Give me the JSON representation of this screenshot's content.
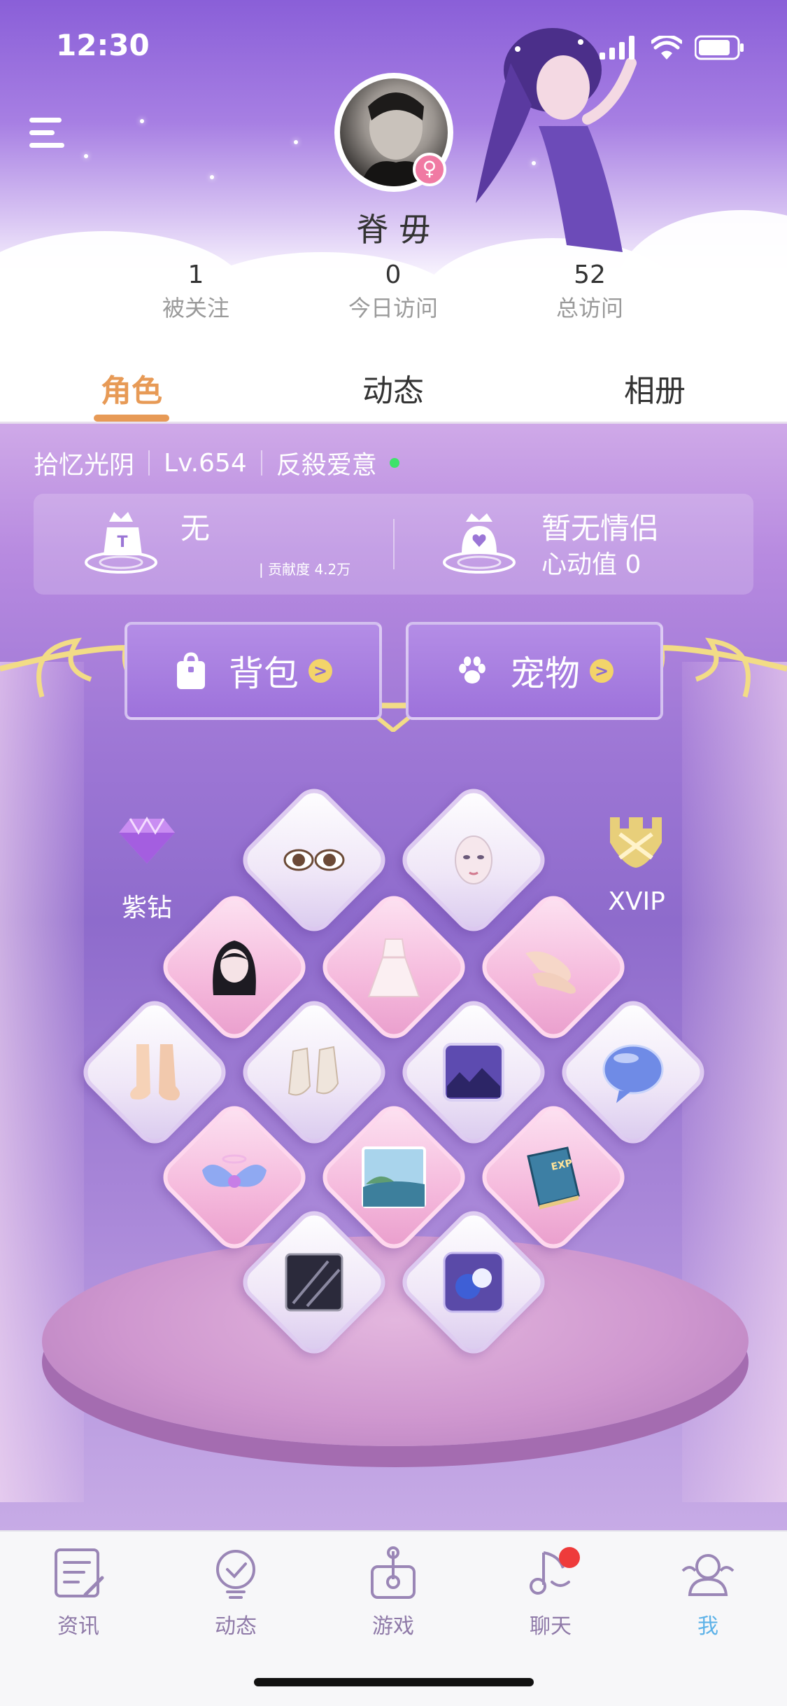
{
  "status_bar": {
    "time": "12:30"
  },
  "profile": {
    "username": "脊 毋",
    "gender_symbol": "♀",
    "stats": [
      {
        "value": "1",
        "label": "被关注"
      },
      {
        "value": "0",
        "label": "今日访问"
      },
      {
        "value": "52",
        "label": "总访问"
      }
    ]
  },
  "tabs": [
    {
      "label": "角色",
      "active": true
    },
    {
      "label": "动态",
      "active": false
    },
    {
      "label": "相册",
      "active": false
    }
  ],
  "role": {
    "name": "拾忆光阴",
    "level": "Lv.654",
    "guild": "反殺爱意",
    "online": true
  },
  "panel": {
    "rank_title": "无",
    "contribution": "| 贡献度 4.2万",
    "couple_title": "暂无情侣",
    "heart_value": "心动值 0"
  },
  "buttons": {
    "backpack": "背包",
    "pet": "宠物",
    "chevron": ">"
  },
  "side": {
    "diamond_label": "紫钻",
    "vip_label": "XVIP"
  },
  "bottom_nav": [
    {
      "label": "资讯",
      "icon": "news-icon",
      "active": false
    },
    {
      "label": "动态",
      "icon": "moments-icon",
      "active": false
    },
    {
      "label": "游戏",
      "icon": "game-icon",
      "active": false
    },
    {
      "label": "聊天",
      "icon": "chat-icon",
      "active": false,
      "badge": true
    },
    {
      "label": "我",
      "icon": "me-icon",
      "active": true
    }
  ],
  "colors": {
    "accent_tab": "#e79a56",
    "active_nav": "#5db2e8",
    "online": "#3ee36a",
    "badge": "#ee3b3b"
  }
}
